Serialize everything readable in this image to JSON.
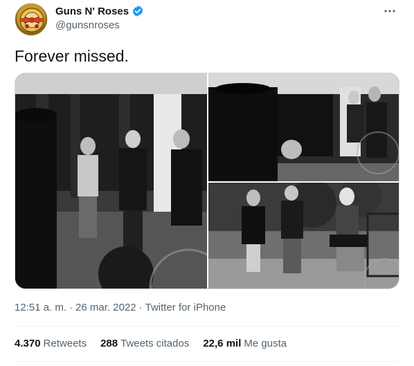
{
  "author": {
    "display_name": "Guns N' Roses",
    "handle": "@gunsnroses",
    "verified": true,
    "avatar_icon": "gnr-logo-avatar"
  },
  "tweet": {
    "text": "Forever missed.",
    "time": "12:51 a. m.",
    "separator": "·",
    "date": "26 mar. 2022",
    "source": "Twitter for iPhone"
  },
  "stats": {
    "retweets_count": "4.370",
    "retweets_label": "Retweets",
    "quotes_count": "288",
    "quotes_label": "Tweets citados",
    "likes_count": "22,6 mil",
    "likes_label": "Me gusta"
  },
  "colors": {
    "text_primary": "#0f1419",
    "text_secondary": "#536471",
    "verified_blue": "#1d9bf0",
    "border": "#cfd9de"
  }
}
